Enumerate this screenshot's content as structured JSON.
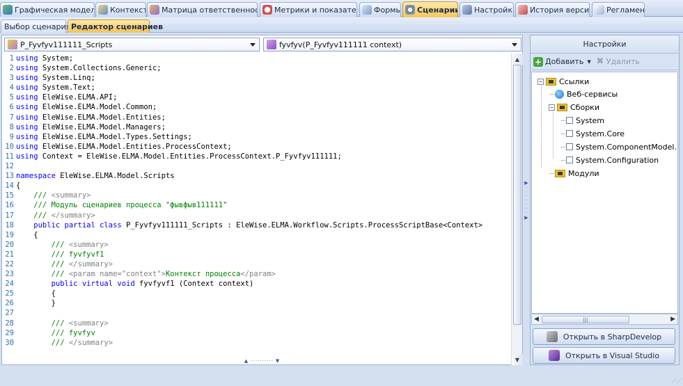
{
  "colors": {
    "accent_tab": "#f5c75a",
    "keyword": "#0000ff",
    "comment": "#008000",
    "comment_tag": "#808080",
    "line_number": "#2f6fa8"
  },
  "tabs": [
    {
      "label": "Графическая модель",
      "icon": "process-diagram-icon",
      "active": false
    },
    {
      "label": "Контекст",
      "icon": "context-icon",
      "active": false
    },
    {
      "label": "Матрица ответственности",
      "icon": "responsibility-matrix-icon",
      "active": false
    },
    {
      "label": "Метрики и показатели",
      "icon": "metrics-gauge-icon",
      "active": false
    },
    {
      "label": "Формы",
      "icon": "forms-icon",
      "active": false
    },
    {
      "label": "Сценарии",
      "icon": "gear-icon",
      "active": true
    },
    {
      "label": "Настройки",
      "icon": "settings-icon",
      "active": false
    },
    {
      "label": "История версий",
      "icon": "version-history-icon",
      "active": false
    },
    {
      "label": "Регламент",
      "icon": "regulation-icon",
      "active": false
    }
  ],
  "subtabs": [
    {
      "label": "Выбор сценария",
      "active": false
    },
    {
      "label": "Редактор сценариев",
      "active": true
    }
  ],
  "editor": {
    "class_dropdown": "P_Fyvfyv111111_Scripts",
    "method_dropdown": "fyvfyv(P_Fyvfyv111111 context)",
    "lines": [
      {
        "n": "1",
        "parts": [
          {
            "t": "kw",
            "s": "using"
          },
          {
            "t": "tx",
            "s": " System;"
          }
        ]
      },
      {
        "n": "2",
        "parts": [
          {
            "t": "kw",
            "s": "using"
          },
          {
            "t": "tx",
            "s": " System.Collections.Generic;"
          }
        ]
      },
      {
        "n": "3",
        "parts": [
          {
            "t": "kw",
            "s": "using"
          },
          {
            "t": "tx",
            "s": " System.Linq;"
          }
        ]
      },
      {
        "n": "4",
        "parts": [
          {
            "t": "kw",
            "s": "using"
          },
          {
            "t": "tx",
            "s": " System.Text;"
          }
        ]
      },
      {
        "n": "5",
        "parts": [
          {
            "t": "kw",
            "s": "using"
          },
          {
            "t": "tx",
            "s": " EleWise.ELMA.API;"
          }
        ]
      },
      {
        "n": "6",
        "parts": [
          {
            "t": "kw",
            "s": "using"
          },
          {
            "t": "tx",
            "s": " EleWise.ELMA.Model.Common;"
          }
        ]
      },
      {
        "n": "7",
        "parts": [
          {
            "t": "kw",
            "s": "using"
          },
          {
            "t": "tx",
            "s": " EleWise.ELMA.Model.Entities;"
          }
        ]
      },
      {
        "n": "8",
        "parts": [
          {
            "t": "kw",
            "s": "using"
          },
          {
            "t": "tx",
            "s": " EleWise.ELMA.Model.Managers;"
          }
        ]
      },
      {
        "n": "9",
        "parts": [
          {
            "t": "kw",
            "s": "using"
          },
          {
            "t": "tx",
            "s": " EleWise.ELMA.Model.Types.Settings;"
          }
        ]
      },
      {
        "n": "10",
        "parts": [
          {
            "t": "kw",
            "s": "using"
          },
          {
            "t": "tx",
            "s": " EleWise.ELMA.Model.Entities.ProcessContext;"
          }
        ]
      },
      {
        "n": "11",
        "parts": [
          {
            "t": "kw",
            "s": "using"
          },
          {
            "t": "tx",
            "s": " Context = EleWise.ELMA.Model.Entities.ProcessContext.P_Fyvfyv111111;"
          }
        ]
      },
      {
        "n": "12",
        "parts": []
      },
      {
        "n": "13",
        "parts": [
          {
            "t": "kw",
            "s": "namespace"
          },
          {
            "t": "tx",
            "s": " EleWise.ELMA.Model.Scripts"
          }
        ]
      },
      {
        "n": "14",
        "parts": [
          {
            "t": "tx",
            "s": "{"
          }
        ]
      },
      {
        "n": "15",
        "parts": [
          {
            "t": "cm",
            "s": "    /// "
          },
          {
            "t": "ct",
            "s": "<summary>"
          }
        ]
      },
      {
        "n": "16",
        "parts": [
          {
            "t": "cm",
            "s": "    /// Модуль сценариев процесса \"фывфыв111111\""
          }
        ]
      },
      {
        "n": "17",
        "parts": [
          {
            "t": "cm",
            "s": "    /// "
          },
          {
            "t": "ct",
            "s": "</summary>"
          }
        ]
      },
      {
        "n": "18",
        "parts": [
          {
            "t": "kw",
            "s": "    public partial class"
          },
          {
            "t": "tx",
            "s": " P_Fyvfyv111111_Scripts : EleWise.ELMA.Workflow.Scripts.ProcessScriptBase<Context>"
          }
        ]
      },
      {
        "n": "19",
        "parts": [
          {
            "t": "tx",
            "s": "    {"
          }
        ]
      },
      {
        "n": "20",
        "parts": [
          {
            "t": "cm",
            "s": "        /// "
          },
          {
            "t": "ct",
            "s": "<summary>"
          }
        ]
      },
      {
        "n": "21",
        "parts": [
          {
            "t": "cm",
            "s": "        /// fyvfyvf1"
          }
        ]
      },
      {
        "n": "22",
        "parts": [
          {
            "t": "cm",
            "s": "        /// "
          },
          {
            "t": "ct",
            "s": "</summary>"
          }
        ]
      },
      {
        "n": "23",
        "parts": [
          {
            "t": "cm",
            "s": "        /// "
          },
          {
            "t": "ct",
            "s": "<param name=\"context\">"
          },
          {
            "t": "cm",
            "s": "Контекст процесса"
          },
          {
            "t": "ct",
            "s": "</param>"
          }
        ]
      },
      {
        "n": "24",
        "parts": [
          {
            "t": "kw",
            "s": "        public virtual void"
          },
          {
            "t": "tx",
            "s": " fyvfyvf1 (Context context)"
          }
        ]
      },
      {
        "n": "25",
        "parts": [
          {
            "t": "tx",
            "s": "        {"
          }
        ]
      },
      {
        "n": "26",
        "parts": [
          {
            "t": "tx",
            "s": "        }"
          }
        ]
      },
      {
        "n": "27",
        "parts": []
      },
      {
        "n": "28",
        "parts": [
          {
            "t": "cm",
            "s": "        /// "
          },
          {
            "t": "ct",
            "s": "<summary>"
          }
        ]
      },
      {
        "n": "29",
        "parts": [
          {
            "t": "cm",
            "s": "        /// fyvfyv"
          }
        ]
      },
      {
        "n": "30",
        "parts": [
          {
            "t": "cm",
            "s": "        /// "
          },
          {
            "t": "ct",
            "s": "</summary>"
          }
        ]
      }
    ]
  },
  "settings_panel": {
    "title": "Настройки",
    "add_label": "Добавить",
    "delete_label": "Удалить",
    "tree": {
      "links": "Ссылки",
      "web_services": "Веб-сервисы",
      "assemblies": "Сборки",
      "assembly_items": [
        "System",
        "System.Core",
        "System.ComponentModel.D",
        "System.Configuration"
      ],
      "modules": "Модули"
    },
    "open_sharpdevelop": "Открыть в SharpDevelop",
    "open_visual_studio": "Открыть в Visual Studio"
  }
}
